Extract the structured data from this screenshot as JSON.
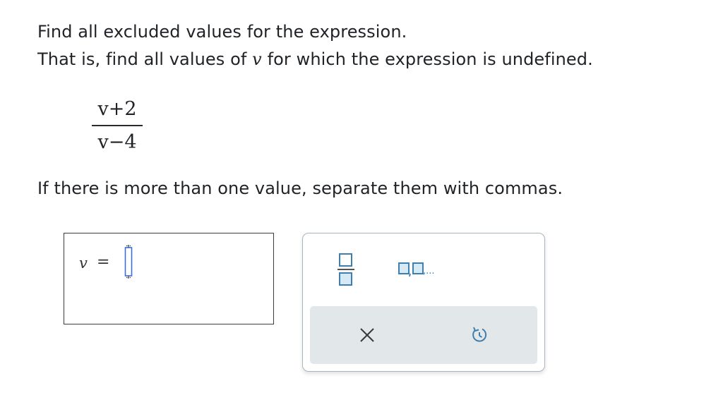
{
  "question": {
    "line1": "Find all excluded values for the expression.",
    "line2_before": "That is, find all values of ",
    "line2_var": "v",
    "line2_after": " for which the expression is undefined.",
    "instruction": "If there is more than one value, separate them with commas."
  },
  "expression": {
    "numerator": "v+2",
    "denominator": "v−4"
  },
  "answer": {
    "variable": "v",
    "equals": "=",
    "value": ""
  },
  "keypad": {
    "fraction_key_icon": "fraction-icon",
    "list_key_icon": "list-of-values-icon",
    "list_key_suffix": ",...",
    "clear_icon": "close-icon",
    "reset_icon": "undo-icon"
  },
  "colors": {
    "keypad_border": "#aab6bf",
    "action_bar": "#e2e7ea",
    "key_icon": "#3f7fb0",
    "key_fill": "#d6eaf5",
    "cursor": "#3d6fd6"
  }
}
